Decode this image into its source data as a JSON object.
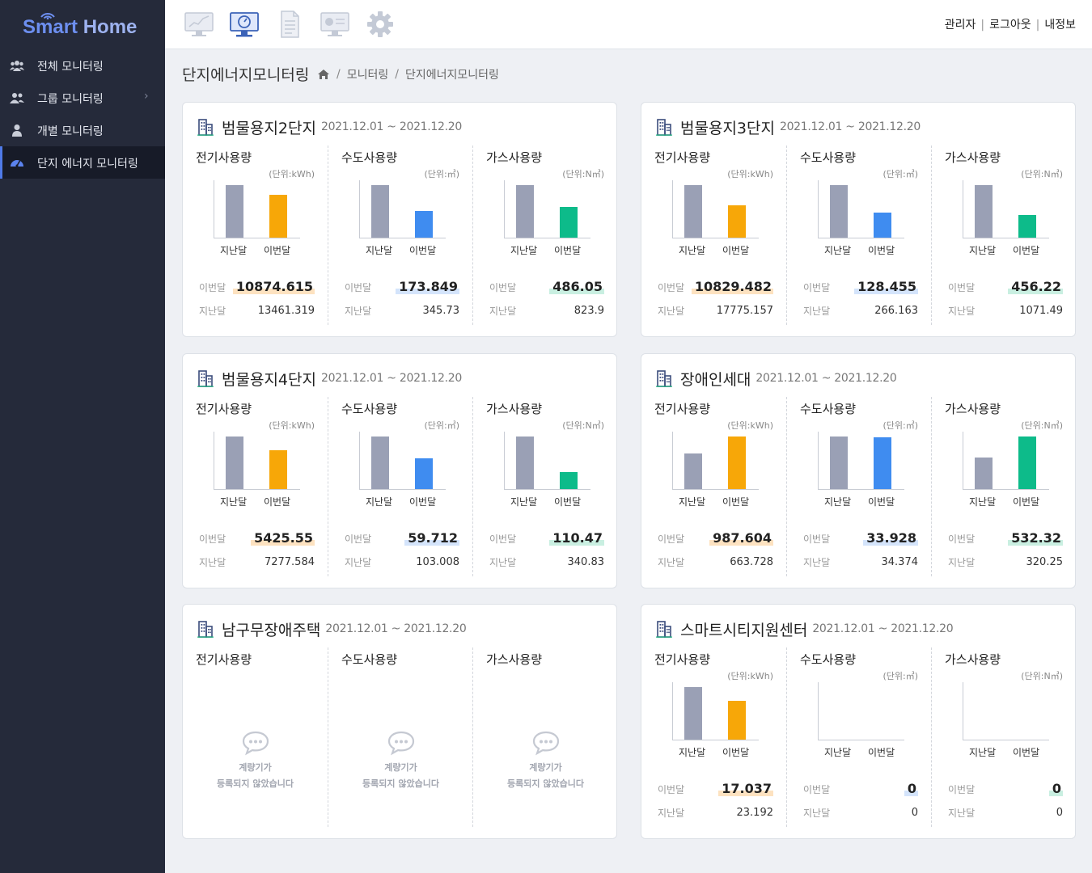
{
  "app": {
    "logo_smart": "Smart",
    "logo_home": " Home"
  },
  "sidebar": {
    "items": [
      {
        "label": "전체 모니터링",
        "icon": "users-icon"
      },
      {
        "label": "그룹 모니터링",
        "icon": "user-group-icon",
        "has_submenu": true,
        "chevron": "›"
      },
      {
        "label": "개별 모니터링",
        "icon": "user-icon"
      },
      {
        "label": "단지 에너지 모니터링",
        "icon": "dashboard-gauge-icon",
        "active": true
      }
    ]
  },
  "topbar": {
    "icons": [
      "monitor-chart-icon",
      "monitor-gauge-icon",
      "document-list-icon",
      "monitor-pie-icon",
      "gear-icon"
    ],
    "active_icon": "monitor-gauge-icon",
    "links": [
      "관리자",
      "로그아웃",
      "내정보"
    ],
    "separator": "|"
  },
  "page": {
    "title": "단지에너지모니터링",
    "breadcrumb": [
      "모니터링",
      "단지에너지모니터링"
    ],
    "breadcrumb_sep": "/"
  },
  "labels": {
    "electric": "전기사용량",
    "water": "수도사용량",
    "gas": "가스사용량",
    "unit_electric": "(단위:kWh)",
    "unit_water": "(단위:㎥)",
    "unit_gas": "(단위:N㎥)",
    "prev": "지난달",
    "curr": "이번달",
    "empty_1": "계량기가",
    "empty_2": "등록되지 않았습니다"
  },
  "colors": {
    "prev_bar": "#9aa0b5",
    "electric": "#f7a708",
    "water": "#3f8cf0",
    "gas": "#0dbb8a",
    "electric_hl": "#fde2c0",
    "water_hl": "#d4e4fb",
    "gas_hl": "#c9efe1"
  },
  "cards": [
    {
      "name": "범물용지2단지",
      "period": "2021.12.01 ~ 2021.12.20",
      "empty": false,
      "electric": {
        "curr": "10874.615",
        "prev": "13461.319"
      },
      "water": {
        "curr": "173.849",
        "prev": "345.73"
      },
      "gas": {
        "curr": "486.05",
        "prev": "823.9"
      }
    },
    {
      "name": "범물용지3단지",
      "period": "2021.12.01 ~ 2021.12.20",
      "empty": false,
      "electric": {
        "curr": "10829.482",
        "prev": "17775.157"
      },
      "water": {
        "curr": "128.455",
        "prev": "266.163"
      },
      "gas": {
        "curr": "456.22",
        "prev": "1071.49"
      }
    },
    {
      "name": "범물용지4단지",
      "period": "2021.12.01 ~ 2021.12.20",
      "empty": false,
      "electric": {
        "curr": "5425.55",
        "prev": "7277.584"
      },
      "water": {
        "curr": "59.712",
        "prev": "103.008"
      },
      "gas": {
        "curr": "110.47",
        "prev": "340.83"
      }
    },
    {
      "name": "장애인세대",
      "period": "2021.12.01 ~ 2021.12.20",
      "empty": false,
      "electric": {
        "curr": "987.604",
        "prev": "663.728"
      },
      "water": {
        "curr": "33.928",
        "prev": "34.374"
      },
      "gas": {
        "curr": "532.32",
        "prev": "320.25"
      }
    },
    {
      "name": "남구무장애주택",
      "period": "2021.12.01 ~ 2021.12.20",
      "empty": true
    },
    {
      "name": "스마트시티지원센터",
      "period": "2021.12.01 ~ 2021.12.20",
      "empty": false,
      "electric": {
        "curr": "17.037",
        "prev": "23.192"
      },
      "water": {
        "curr": "0",
        "prev": "0"
      },
      "gas": {
        "curr": "0",
        "prev": "0"
      }
    }
  ]
}
